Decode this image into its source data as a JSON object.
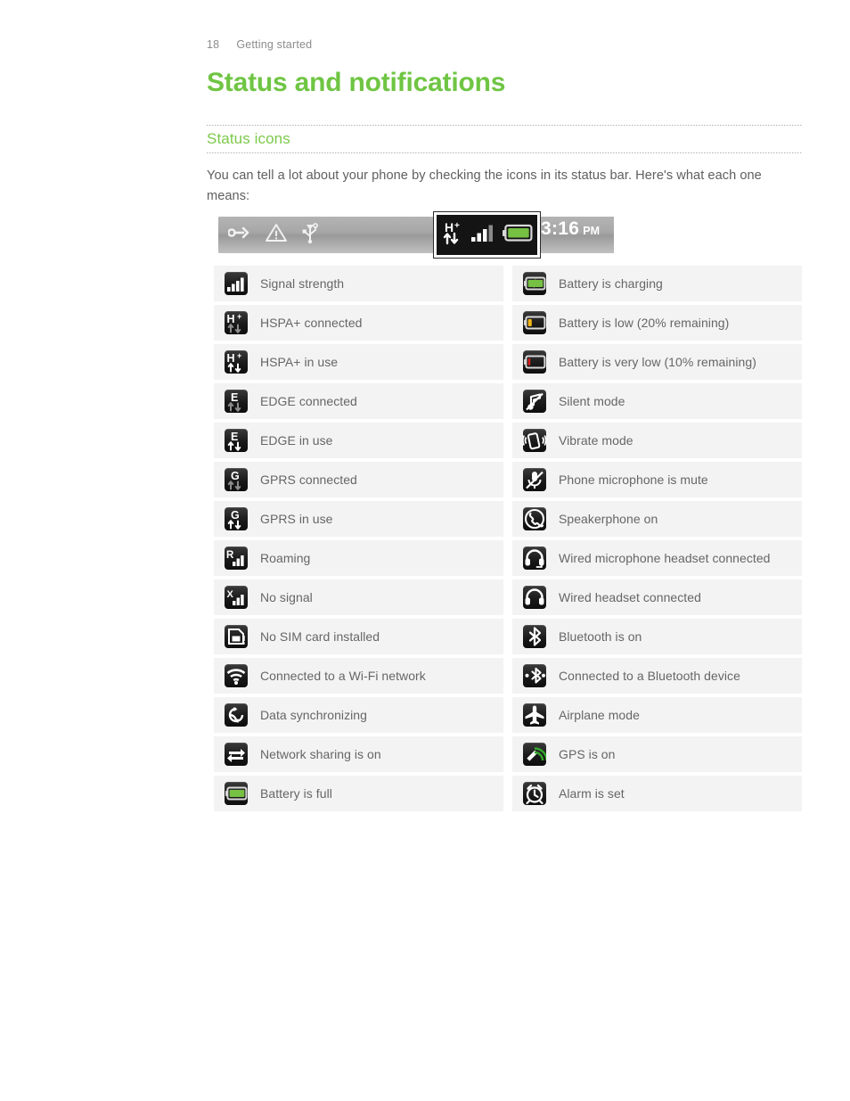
{
  "header": {
    "page_number": "18",
    "running_title": "Getting started"
  },
  "chapter": {
    "title": "Status and notifications"
  },
  "section": {
    "title": "Status icons",
    "body": "You can tell a lot about your phone by checking the icons in its status bar. Here's what each one means:"
  },
  "status_bar_figure": {
    "notification_icons": [
      "link-icon",
      "warning-triangle-icon",
      "usb-icon"
    ],
    "highlighted_status_icons": [
      "hspa-plus-in-use-icon",
      "signal-strength-icon",
      "battery-full-icon"
    ],
    "clock_time": "3:16",
    "clock_ampm": "PM"
  },
  "colors": {
    "accent_green": "#6fc543",
    "section_green": "#7dc94a",
    "row_background": "#f3f3f3",
    "label_text": "#666666",
    "body_text": "#5f5f5f",
    "battery_green": "#76c043",
    "battery_yellow": "#f2b417",
    "battery_red": "#d81f1f",
    "gps_green": "#35a72b"
  },
  "icon_table": {
    "left_column": [
      {
        "icon": "signal-strength-icon",
        "label": "Signal strength"
      },
      {
        "icon": "hspa-plus-connected-icon",
        "label": "HSPA+ connected"
      },
      {
        "icon": "hspa-plus-in-use-icon",
        "label": "HSPA+ in use"
      },
      {
        "icon": "edge-connected-icon",
        "label": "EDGE connected"
      },
      {
        "icon": "edge-in-use-icon",
        "label": "EDGE in use"
      },
      {
        "icon": "gprs-connected-icon",
        "label": "GPRS connected"
      },
      {
        "icon": "gprs-in-use-icon",
        "label": "GPRS in use"
      },
      {
        "icon": "roaming-icon",
        "label": "Roaming"
      },
      {
        "icon": "no-signal-icon",
        "label": "No signal"
      },
      {
        "icon": "no-sim-card-icon",
        "label": "No SIM card installed"
      },
      {
        "icon": "wifi-connected-icon",
        "label": "Connected to a Wi-Fi network"
      },
      {
        "icon": "data-sync-icon",
        "label": "Data synchronizing"
      },
      {
        "icon": "network-sharing-icon",
        "label": "Network sharing is on"
      },
      {
        "icon": "battery-full-icon",
        "label": "Battery is full"
      }
    ],
    "right_column": [
      {
        "icon": "battery-charging-icon",
        "label": "Battery is charging"
      },
      {
        "icon": "battery-low-icon",
        "label": "Battery is low (20% remaining)"
      },
      {
        "icon": "battery-very-low-icon",
        "label": "Battery is very low (10% remaining)"
      },
      {
        "icon": "silent-mode-icon",
        "label": "Silent mode"
      },
      {
        "icon": "vibrate-mode-icon",
        "label": "Vibrate mode"
      },
      {
        "icon": "microphone-mute-icon",
        "label": "Phone microphone is mute"
      },
      {
        "icon": "speakerphone-icon",
        "label": "Speakerphone on"
      },
      {
        "icon": "wired-mic-headset-icon",
        "label": "Wired microphone headset connected"
      },
      {
        "icon": "wired-headset-icon",
        "label": "Wired headset connected"
      },
      {
        "icon": "bluetooth-on-icon",
        "label": "Bluetooth is on"
      },
      {
        "icon": "bluetooth-connected-icon",
        "label": "Connected to a Bluetooth device"
      },
      {
        "icon": "airplane-mode-icon",
        "label": "Airplane mode"
      },
      {
        "icon": "gps-on-icon",
        "label": "GPS is on"
      },
      {
        "icon": "alarm-set-icon",
        "label": "Alarm is set"
      }
    ]
  }
}
